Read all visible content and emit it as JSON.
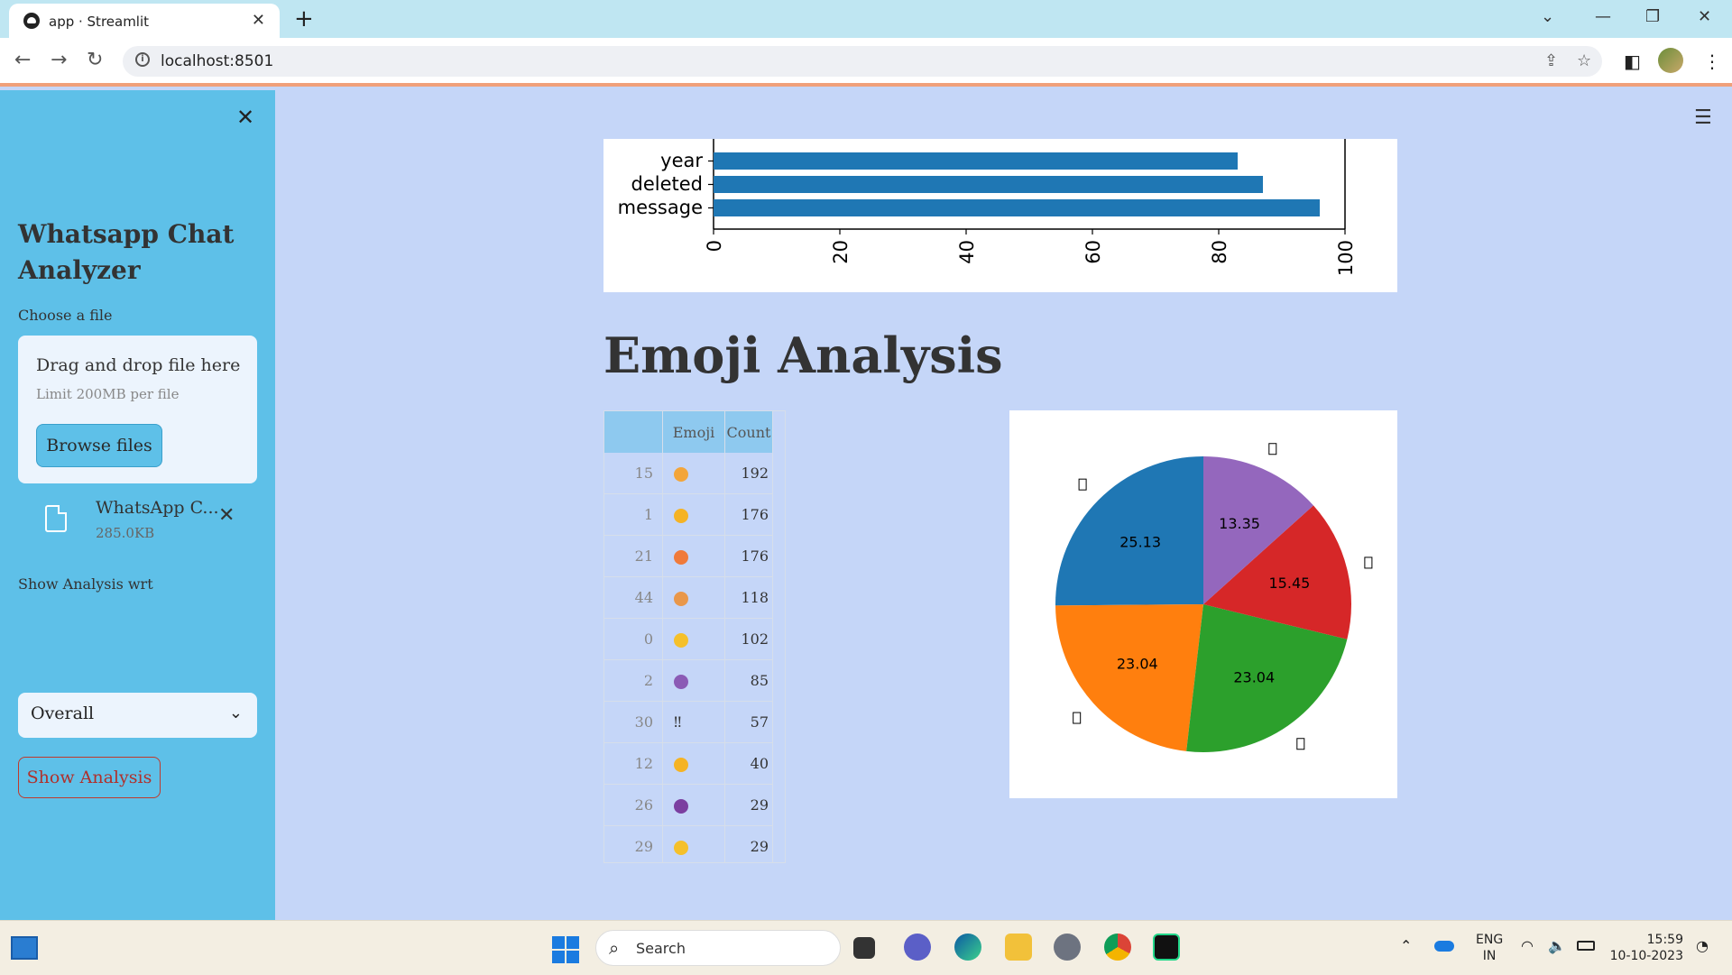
{
  "browser": {
    "tab_title": "app · Streamlit",
    "tab_close": "✕",
    "new_tab": "+",
    "url": "localhost:8501",
    "window_controls": [
      "⌄",
      "—",
      "❐",
      "✕"
    ],
    "nav": {
      "back": "←",
      "forward": "→",
      "reload": "↻"
    }
  },
  "sidebar": {
    "close": "✕",
    "title": "Whatsapp Chat Analyzer",
    "file_label": "Choose a file",
    "dropzone_text": "Drag and drop file here",
    "dropzone_limit": "Limit 200MB per file",
    "browse_button": "Browse files",
    "uploaded_file_name": "WhatsApp C...",
    "uploaded_file_size": "285.0KB",
    "file_remove": "✕",
    "analysis_label": "Show Analysis wrt",
    "analysis_selected": "Overall",
    "show_button": "Show Analysis"
  },
  "main": {
    "menu_icon": "☰",
    "emoji_title": "Emoji Analysis",
    "table": {
      "columns": [
        "",
        "Emoji",
        "Count"
      ],
      "rows": [
        {
          "index": "15",
          "emoji_color": "#f3a53a",
          "emoji": "😥",
          "count": "192"
        },
        {
          "index": "1",
          "emoji_color": "#f5b324",
          "emoji": "😂",
          "count": "176"
        },
        {
          "index": "21",
          "emoji_color": "#f07a3a",
          "emoji": "🤣",
          "count": "176"
        },
        {
          "index": "44",
          "emoji_color": "#e9974a",
          "emoji": "🥳",
          "count": "118"
        },
        {
          "index": "0",
          "emoji_color": "#f5c02a",
          "emoji": "🙂",
          "count": "102"
        },
        {
          "index": "2",
          "emoji_color": "#8b5bb5",
          "emoji": "😈",
          "count": "85"
        },
        {
          "index": "30",
          "emoji_color": "",
          "emoji": "‼",
          "count": "57"
        },
        {
          "index": "12",
          "emoji_color": "#f5b324",
          "emoji": "🙃",
          "count": "40"
        },
        {
          "index": "26",
          "emoji_color": "#7b3fa0",
          "emoji": "👿",
          "count": "29"
        },
        {
          "index": "29",
          "emoji_color": "#f5c02a",
          "emoji": "😌",
          "count": "29"
        }
      ]
    }
  },
  "chart_data": [
    {
      "type": "bar",
      "orientation": "horizontal",
      "categories": [
        "message",
        "deleted",
        "year"
      ],
      "values": [
        96,
        87,
        83
      ],
      "xlim": [
        0,
        100
      ],
      "xticks": [
        "0",
        "20",
        "40",
        "60",
        "80",
        "100"
      ],
      "color": "#1f77b4",
      "note_partial": "chart is scrolled; only the bottom three bars are visible"
    },
    {
      "type": "pie",
      "slices": [
        {
          "value": 25.13,
          "label": "25.13",
          "color": "#1f77b4"
        },
        {
          "value": 23.04,
          "label": "23.04",
          "color": "#ff7f0e"
        },
        {
          "value": 23.04,
          "label": "23.04",
          "color": "#2ca02c"
        },
        {
          "value": 15.45,
          "label": "15.45",
          "color": "#d62728"
        },
        {
          "value": 13.35,
          "label": "13.35",
          "color": "#9467bd"
        }
      ],
      "start_angle_deg": 90,
      "direction": "counterclockwise"
    }
  ],
  "taskbar": {
    "search_text": "Search",
    "lang_line1": "ENG",
    "lang_line2": "IN",
    "time": "15:59",
    "date": "10-10-2023",
    "icons": [
      "widgets-icon",
      "start-icon",
      "task-view-icon",
      "teams-icon",
      "edge-icon",
      "file-explorer-icon",
      "settings-icon",
      "chrome-icon",
      "pycharm-icon"
    ]
  }
}
